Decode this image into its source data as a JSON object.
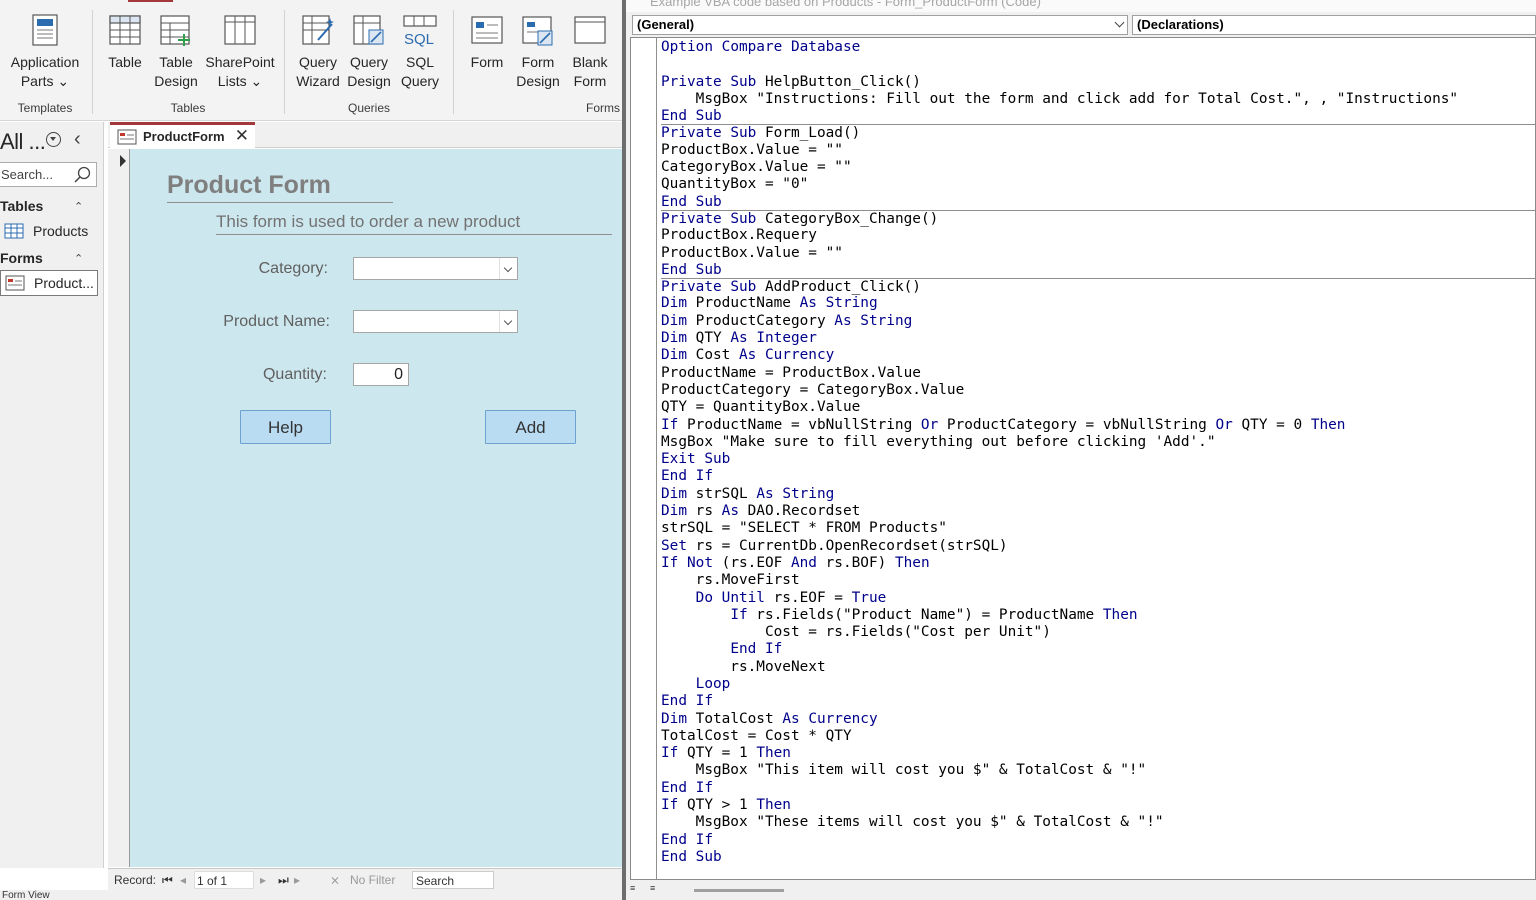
{
  "ribbon": {
    "buttons": [
      {
        "id": "application-parts",
        "line1": "Application",
        "line2": "Parts ⌄"
      },
      {
        "id": "table",
        "line1": "Table",
        "line2": ""
      },
      {
        "id": "table-design",
        "line1": "Table",
        "line2": "Design"
      },
      {
        "id": "sharepoint-lists",
        "line1": "SharePoint",
        "line2": "Lists ⌄"
      },
      {
        "id": "query-wizard",
        "line1": "Query",
        "line2": "Wizard"
      },
      {
        "id": "query-design",
        "line1": "Query",
        "line2": "Design"
      },
      {
        "id": "sql-query",
        "line1": "SQL",
        "line2": "Query"
      },
      {
        "id": "form",
        "line1": "Form",
        "line2": ""
      },
      {
        "id": "form-design",
        "line1": "Form",
        "line2": "Design"
      },
      {
        "id": "blank-form",
        "line1": "Blank",
        "line2": "Form"
      }
    ],
    "groups": [
      "Templates",
      "Tables",
      "Queries",
      "Forms"
    ],
    "icon_color": "#2b579a"
  },
  "nav": {
    "title": "All ...",
    "search_placeholder": "Search...",
    "sections": [
      {
        "header": "Tables",
        "items": [
          "Products"
        ]
      },
      {
        "header": "Forms",
        "items": [
          "Product..."
        ]
      }
    ]
  },
  "document": {
    "tab_label": "ProductForm",
    "accent": "#a4373a",
    "form": {
      "title": "Product Form",
      "subtitle": "This form is used to order a new product",
      "category_label": "Category:",
      "product_name_label": "Product Name:",
      "quantity_label": "Quantity:",
      "quantity_value": "0",
      "help_button": "Help",
      "add_button": "Add"
    },
    "status": {
      "record_label": "Record:",
      "record_value": "1 of 1",
      "filter_label": "No Filter",
      "search_label": "Search"
    },
    "bottom_status": "Form View"
  },
  "vba": {
    "window_title": "Example VBA code based on Products - Form_ProductForm (Code)",
    "object_combo": "(General)",
    "procedure_combo": "(Declarations)",
    "code_lines": [
      {
        "text": "Option Compare Database",
        "sep": false
      },
      {
        "text": "",
        "sep": false
      },
      {
        "text": "Private Sub HelpButton_Click()",
        "sep": false
      },
      {
        "text": "    MsgBox \"Instructions: Fill out the form and click add for Total Cost.\", , \"Instructions\"",
        "sep": false
      },
      {
        "text": "End Sub",
        "sep": false
      },
      {
        "text": "Private Sub Form_Load()",
        "sep": true
      },
      {
        "text": "ProductBox.Value = \"\"",
        "sep": false
      },
      {
        "text": "CategoryBox.Value = \"\"",
        "sep": false
      },
      {
        "text": "QuantityBox = \"0\"",
        "sep": false
      },
      {
        "text": "End Sub",
        "sep": false
      },
      {
        "text": "Private Sub CategoryBox_Change()",
        "sep": true
      },
      {
        "text": "ProductBox.Requery",
        "sep": false
      },
      {
        "text": "ProductBox.Value = \"\"",
        "sep": false
      },
      {
        "text": "End Sub",
        "sep": false
      },
      {
        "text": "Private Sub AddProduct_Click()",
        "sep": true
      },
      {
        "text": "Dim ProductName As String",
        "sep": false
      },
      {
        "text": "Dim ProductCategory As String",
        "sep": false
      },
      {
        "text": "Dim QTY As Integer",
        "sep": false
      },
      {
        "text": "Dim Cost As Currency",
        "sep": false
      },
      {
        "text": "ProductName = ProductBox.Value",
        "sep": false
      },
      {
        "text": "ProductCategory = CategoryBox.Value",
        "sep": false
      },
      {
        "text": "QTY = QuantityBox.Value",
        "sep": false
      },
      {
        "text": "If ProductName = vbNullString Or ProductCategory = vbNullString Or QTY = 0 Then",
        "sep": false
      },
      {
        "text": "MsgBox \"Make sure to fill everything out before clicking 'Add'.\"",
        "sep": false
      },
      {
        "text": "Exit Sub",
        "sep": false
      },
      {
        "text": "End If",
        "sep": false
      },
      {
        "text": "Dim strSQL As String",
        "sep": false
      },
      {
        "text": "Dim rs As DAO.Recordset",
        "sep": false
      },
      {
        "text": "strSQL = \"SELECT * FROM Products\"",
        "sep": false
      },
      {
        "text": "Set rs = CurrentDb.OpenRecordset(strSQL)",
        "sep": false
      },
      {
        "text": "If Not (rs.EOF And rs.BOF) Then",
        "sep": false
      },
      {
        "text": "    rs.MoveFirst",
        "sep": false
      },
      {
        "text": "    Do Until rs.EOF = True",
        "sep": false
      },
      {
        "text": "        If rs.Fields(\"Product Name\") = ProductName Then",
        "sep": false
      },
      {
        "text": "            Cost = rs.Fields(\"Cost per Unit\")",
        "sep": false
      },
      {
        "text": "        End If",
        "sep": false
      },
      {
        "text": "        rs.MoveNext",
        "sep": false
      },
      {
        "text": "    Loop",
        "sep": false
      },
      {
        "text": "End If",
        "sep": false
      },
      {
        "text": "Dim TotalCost As Currency",
        "sep": false
      },
      {
        "text": "TotalCost = Cost * QTY",
        "sep": false
      },
      {
        "text": "If QTY = 1 Then",
        "sep": false
      },
      {
        "text": "    MsgBox \"This item will cost you $\" & TotalCost & \"!\"",
        "sep": false
      },
      {
        "text": "End If",
        "sep": false
      },
      {
        "text": "If QTY > 1 Then",
        "sep": false
      },
      {
        "text": "    MsgBox \"These items will cost you $\" & TotalCost & \"!\"",
        "sep": false
      },
      {
        "text": "End If",
        "sep": false
      },
      {
        "text": "End Sub",
        "sep": false
      }
    ],
    "keyword_color": "#00008b"
  }
}
